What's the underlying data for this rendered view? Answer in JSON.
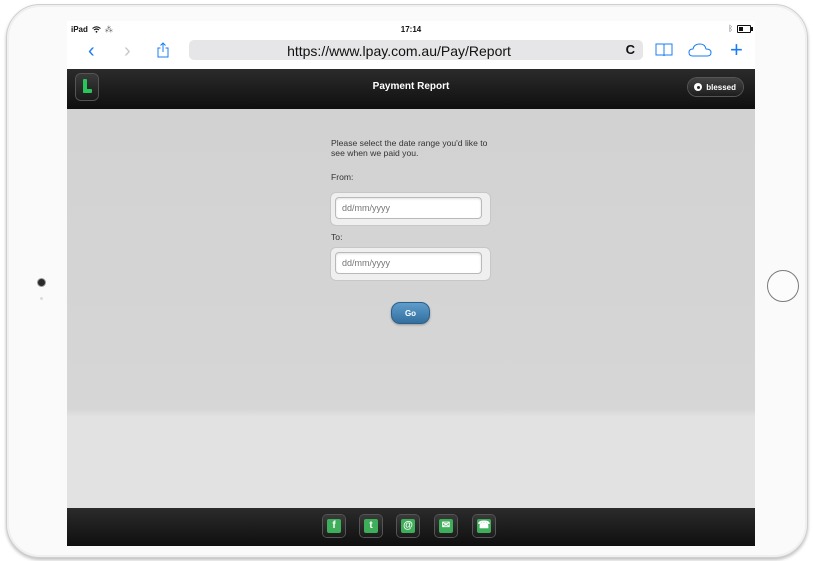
{
  "device": {
    "model": "iPad",
    "wifi_icon": "wifi-icon",
    "time": "17:14",
    "bluetooth_icon": "bluetooth-icon",
    "battery_level": 0.4
  },
  "browser": {
    "url": "https://www.lpay.com.au/Pay/Report",
    "back_icon": "chevron-left-icon",
    "forward_icon": "chevron-right-icon",
    "share_icon": "share-icon",
    "reload_icon": "reload-icon",
    "bookmarks_icon": "bookmarks-icon",
    "cloud_tabs_icon": "cloud-icon",
    "new_tab_icon": "plus-icon",
    "accent_color": "#1a7cf5"
  },
  "app": {
    "logo_letter": "L",
    "title": "Payment Report",
    "user_name": "blessed",
    "brand_color": "#29c55b"
  },
  "form": {
    "prompt": "Please select the date range you'd like to see when we paid you.",
    "from_label": "From:",
    "from_placeholder": "dd/mm/yyyy",
    "to_label": "To:",
    "to_placeholder": "dd/mm/yyyy",
    "go_label": "Go",
    "button_color": "#3f7fb0"
  },
  "footer": {
    "social": [
      {
        "icon": "facebook-icon",
        "glyph": "f"
      },
      {
        "icon": "twitter-icon",
        "glyph": "t"
      },
      {
        "icon": "website-icon",
        "glyph": "@"
      },
      {
        "icon": "email-icon",
        "glyph": "✉"
      },
      {
        "icon": "phone-icon",
        "glyph": "☎"
      }
    ],
    "icon_color": "#3fae5a"
  }
}
